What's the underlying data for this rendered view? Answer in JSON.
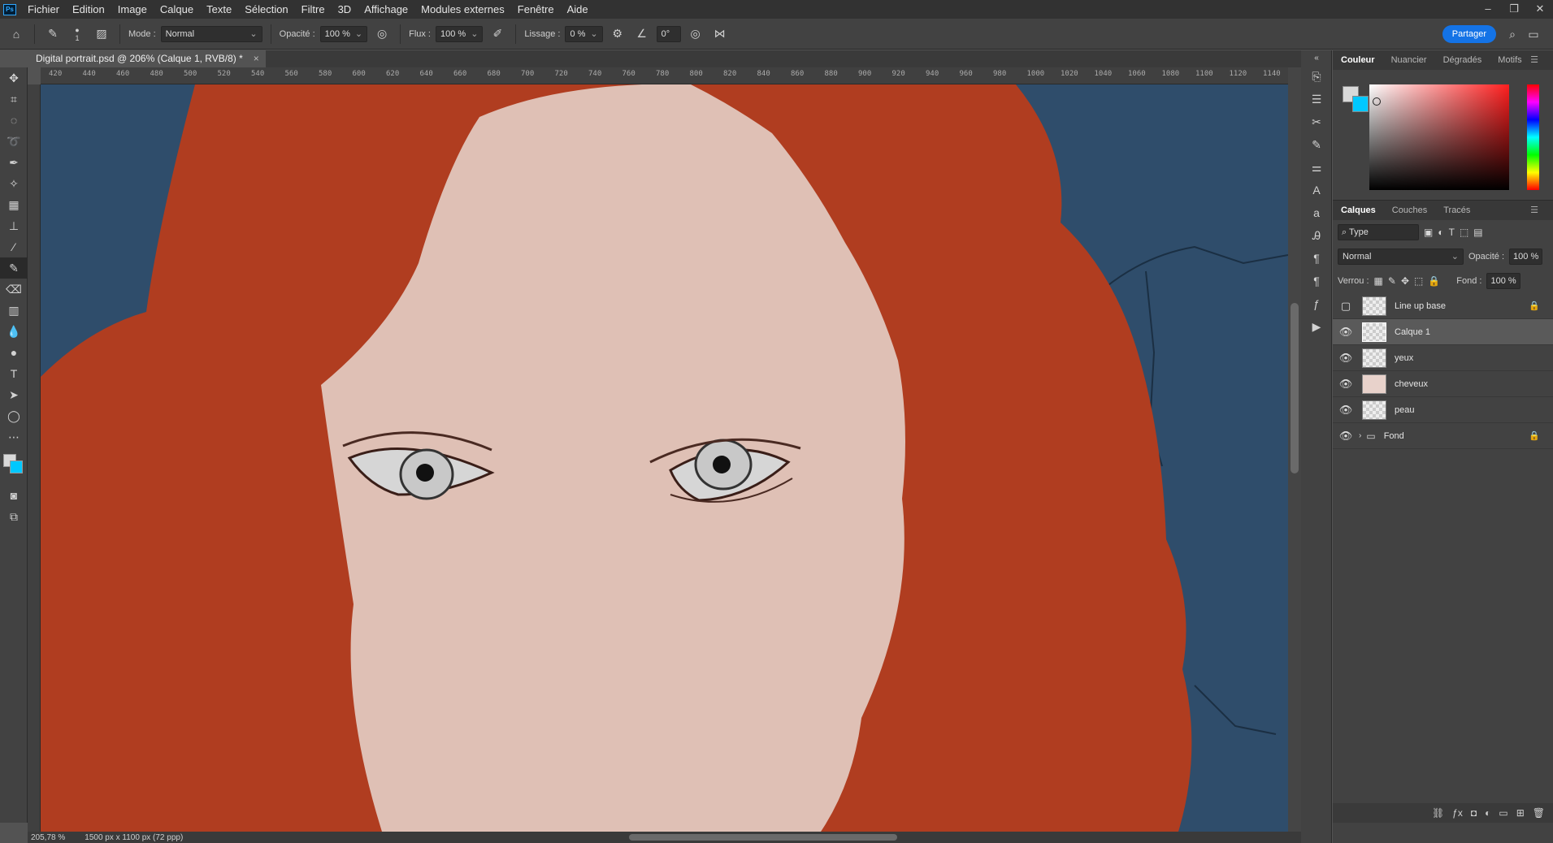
{
  "menu": {
    "logo": "Ps",
    "items": [
      "Fichier",
      "Edition",
      "Image",
      "Calque",
      "Texte",
      "Sélection",
      "Filtre",
      "3D",
      "Affichage",
      "Modules externes",
      "Fenêtre",
      "Aide"
    ],
    "window_controls": [
      "–",
      "❐",
      "✕"
    ]
  },
  "options": {
    "brush_size": "1",
    "mode_label": "Mode :",
    "mode_value": "Normal",
    "opacity_label": "Opacité :",
    "opacity_value": "100 %",
    "flow_label": "Flux :",
    "flow_value": "100 %",
    "smoothing_label": "Lissage :",
    "smoothing_value": "0 %",
    "angle_value": "0°",
    "share_label": "Partager"
  },
  "document": {
    "tab_title": "Digital portrait.psd @ 206% (Calque 1, RVB/8) *",
    "close": "×"
  },
  "ruler_h": [
    "420",
    "440",
    "460",
    "480",
    "500",
    "520",
    "540",
    "560",
    "580",
    "600",
    "620",
    "640",
    "660",
    "680",
    "700",
    "720",
    "740",
    "760",
    "780",
    "800",
    "820",
    "840",
    "860",
    "880",
    "900",
    "920",
    "940",
    "960",
    "980",
    "1000",
    "1020",
    "1040",
    "1060",
    "1080",
    "1100",
    "1120",
    "1140"
  ],
  "status": {
    "zoom": "205,78 %",
    "dimensions": "1500 px x 1100 px (72 ppp)"
  },
  "color_panel": {
    "tabs": [
      "Couleur",
      "Nuancier",
      "Dégradés",
      "Motifs"
    ],
    "foreground": "#d9d9d9",
    "background": "#00c8ff"
  },
  "layers_panel": {
    "tabs": [
      "Calques",
      "Couches",
      "Tracés"
    ],
    "filter_label": "Type",
    "blend_mode": "Normal",
    "opacity_label": "Opacité :",
    "opacity_value": "100 %",
    "lock_label": "Verrou :",
    "fill_label": "Fond :",
    "fill_value": "100 %",
    "layers": [
      {
        "name": "Line up base",
        "visible": false,
        "locked": true
      },
      {
        "name": "Calque 1",
        "visible": true,
        "locked": false,
        "selected": true
      },
      {
        "name": "yeux",
        "visible": true,
        "locked": false
      },
      {
        "name": "cheveux",
        "visible": true,
        "locked": false
      },
      {
        "name": "peau",
        "visible": true,
        "locked": false
      },
      {
        "name": "Fond",
        "visible": true,
        "locked": true,
        "group": true
      }
    ]
  },
  "colors": {
    "hair": "#b03d20",
    "skin": "#dfc0b5",
    "background_wall": "#2f4d6b",
    "accent": "#1473e6"
  }
}
